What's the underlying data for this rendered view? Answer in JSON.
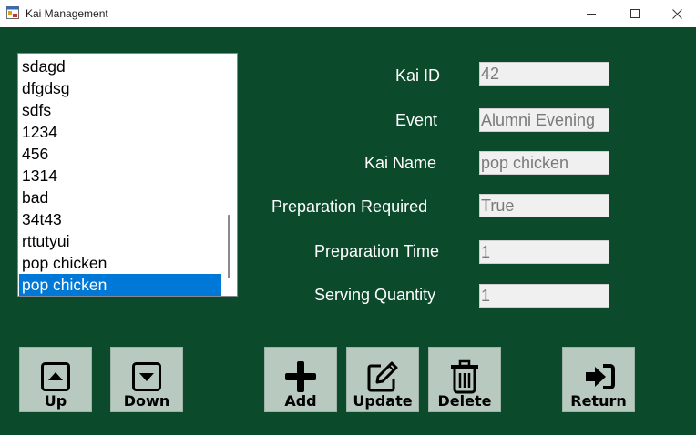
{
  "window": {
    "title": "Kai Management"
  },
  "kai_list": {
    "items": [
      "sdagd",
      "dfgdsg",
      "sdfs",
      "1234",
      "456",
      "1314",
      "bad",
      "34t43",
      "rttutyui",
      "pop chicken",
      "pop chicken"
    ],
    "selected_index": 10
  },
  "form": {
    "kai_id": {
      "label": "Kai ID",
      "value": "42"
    },
    "event": {
      "label": "Event",
      "value": "Alumni Evening"
    },
    "kai_name": {
      "label": "Kai Name",
      "value": "pop chicken"
    },
    "preparation_required": {
      "label": "Preparation Required",
      "value": "True"
    },
    "preparation_time": {
      "label": "Preparation Time",
      "value": "1"
    },
    "serving_quantity": {
      "label": "Serving Quantity",
      "value": "1"
    }
  },
  "buttons": {
    "up": {
      "label": "Up",
      "icon": "arrow-up-box-icon"
    },
    "down": {
      "label": "Down",
      "icon": "arrow-down-box-icon"
    },
    "add": {
      "label": "Add",
      "icon": "plus-icon"
    },
    "update": {
      "label": "Update",
      "icon": "edit-icon"
    },
    "delete": {
      "label": "Delete",
      "icon": "trash-icon"
    },
    "return": {
      "label": "Return",
      "icon": "sign-out-icon"
    }
  },
  "colors": {
    "background": "#0b4a2a",
    "button": "#b8c9bf",
    "selection": "#0078d7",
    "input_bg": "#f0f0f0"
  }
}
